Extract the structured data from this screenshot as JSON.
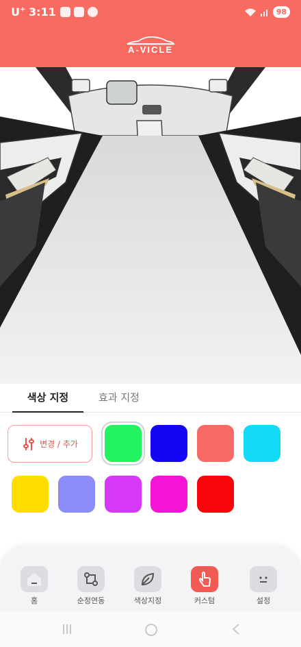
{
  "status_bar": {
    "carrier": "U",
    "carrier_sup": "+",
    "time": "3:11",
    "battery": "98"
  },
  "brand": {
    "logo_text": "A-VICLE",
    "color": "#f96a60"
  },
  "tabs": [
    {
      "label": "색상 지정",
      "active": true
    },
    {
      "label": "효과 지정",
      "active": false
    }
  ],
  "palette": {
    "edit_label": "변경 / 추가",
    "swatches": [
      {
        "color": "#22f35e",
        "selected": true
      },
      {
        "color": "#1405f5",
        "selected": false
      },
      {
        "color": "#f96a66",
        "selected": false
      },
      {
        "color": "#12d9f6",
        "selected": false
      },
      {
        "color": "#ffdd00",
        "selected": false
      },
      {
        "color": "#8b8cf8",
        "selected": false
      },
      {
        "color": "#d538f6",
        "selected": false
      },
      {
        "color": "#f515d8",
        "selected": false
      },
      {
        "color": "#f80409",
        "selected": false
      }
    ]
  },
  "bottom_nav": [
    {
      "label": "홈",
      "icon": "home-icon",
      "active": false
    },
    {
      "label": "순정연동",
      "icon": "sync-icon",
      "active": false
    },
    {
      "label": "색상지정",
      "icon": "leaf-icon",
      "active": false
    },
    {
      "label": "커스텀",
      "icon": "touch-hand-icon",
      "active": true
    },
    {
      "label": "설정",
      "icon": "face-settings-icon",
      "active": false
    }
  ],
  "system_nav": [
    "recent-apps-icon",
    "home-circle-icon",
    "back-icon"
  ]
}
